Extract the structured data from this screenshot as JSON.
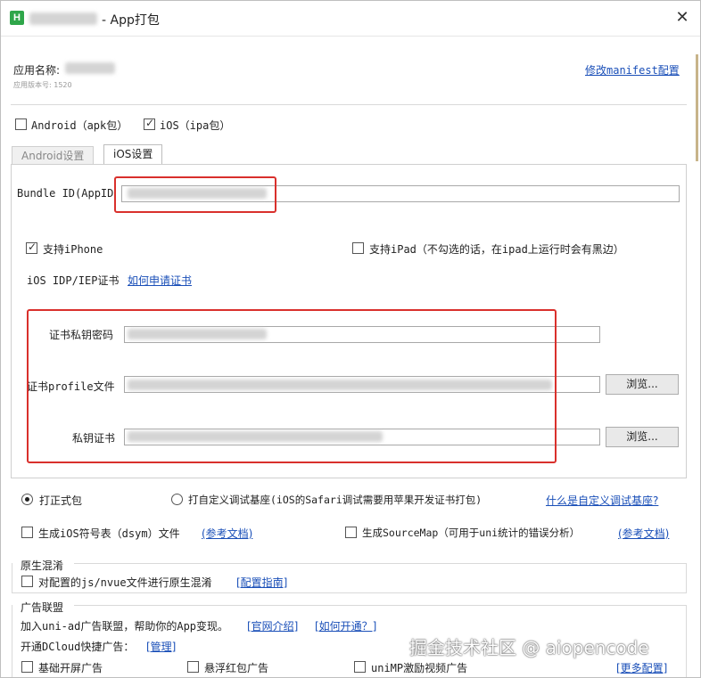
{
  "window": {
    "title": "- App打包",
    "close_icon": "✕"
  },
  "app": {
    "name_label": "应用名称:",
    "version_note": "应用版本号: 1520",
    "edit_manifest_link": "修改manifest配置"
  },
  "platforms": {
    "android_label": "Android（apk包）",
    "android_checked": false,
    "ios_label": "iOS（ipa包）",
    "ios_checked": true
  },
  "tabs": [
    {
      "label": "Android设置",
      "active": false
    },
    {
      "label": "iOS设置",
      "active": true
    }
  ],
  "ios": {
    "bundle_id_label": "Bundle ID(AppID",
    "support_iphone_label": "支持iPhone",
    "support_iphone_checked": true,
    "support_ipad_label": "支持iPad（不勾选的话，在ipad上运行时会有黑边）",
    "support_ipad_checked": false,
    "cert_label": "iOS IDP/IEP证书",
    "cert_link": "如何申请证书",
    "private_key_password_label": "证书私钥密码",
    "profile_label": "证书profile文件",
    "private_key_cert_label": "私钥证书",
    "browse_label": "浏览..."
  },
  "build": {
    "formal_label": "打正式包",
    "formal_checked": true,
    "custom_base_label": "打自定义调试基座(iOS的Safari调试需要用苹果开发证书打包)",
    "custom_base_checked": false,
    "custom_base_link": "什么是自定义调试基座?",
    "dsym_label": "生成iOS符号表（dsym）文件",
    "dsym_link": "(参考文档)",
    "sourcemap_label": "生成SourceMap（可用于uni统计的错误分析）",
    "sourcemap_link": "(参考文档)"
  },
  "obfuscation": {
    "title": "原生混淆",
    "option_label": "对配置的js/nvue文件进行原生混淆",
    "guide_link": "[配置指南]"
  },
  "ads": {
    "title": "广告联盟",
    "intro_text": "加入uni-ad广告联盟，帮助你的App变现。",
    "intro_link_1": "[官网介绍]",
    "intro_link_2": "[如何开通？]",
    "quick_ad_text": "开通DCloud快捷广告：",
    "manage_link": "[管理]",
    "splash_label": "基础开屏广告",
    "redpacket_label": "悬浮红包广告",
    "reward_video_label": "uniMP激励视频广告",
    "more_link": "[更多配置]"
  },
  "watermark": "掘金技术社区 @ aiopencode",
  "colors": {
    "link": "#1a4fb8",
    "highlight_box": "#d9302c",
    "app_icon": "#2fa64a"
  }
}
